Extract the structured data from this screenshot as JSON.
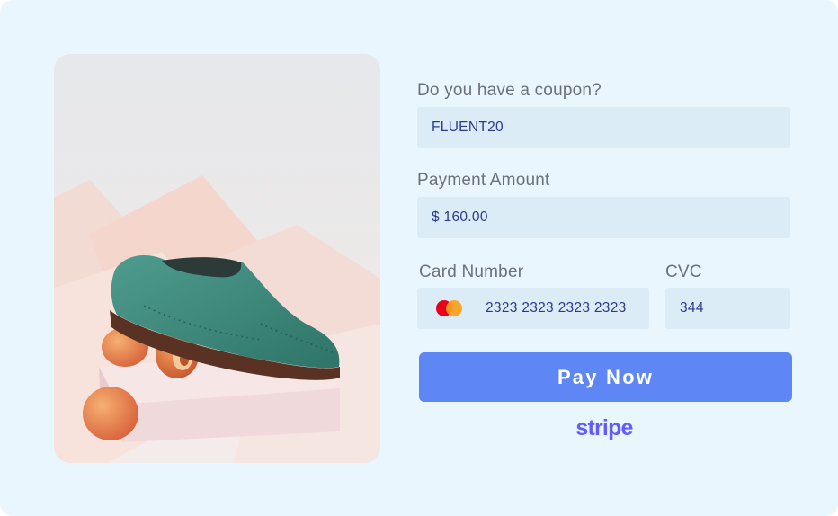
{
  "product": {
    "image_alt": "Green suede brogue shoe resting on peaches"
  },
  "coupon": {
    "label": "Do you have a coupon?",
    "value": "FLUENT20"
  },
  "payment_amount": {
    "label": "Payment Amount",
    "value": "$ 160.00"
  },
  "card_number": {
    "label": "Card Number",
    "value": "2323 2323 2323 2323",
    "icon": "mastercard-icon"
  },
  "cvc": {
    "label": "CVC",
    "value": "344"
  },
  "pay_button": {
    "label": "Pay Now"
  },
  "brand": {
    "logo_text": "stripe"
  },
  "colors": {
    "background": "#eaf6fe",
    "field_bg": "#dcecf6",
    "button": "#5e87f5",
    "stripe": "#635bff",
    "value_text": "#2b3a8f"
  }
}
